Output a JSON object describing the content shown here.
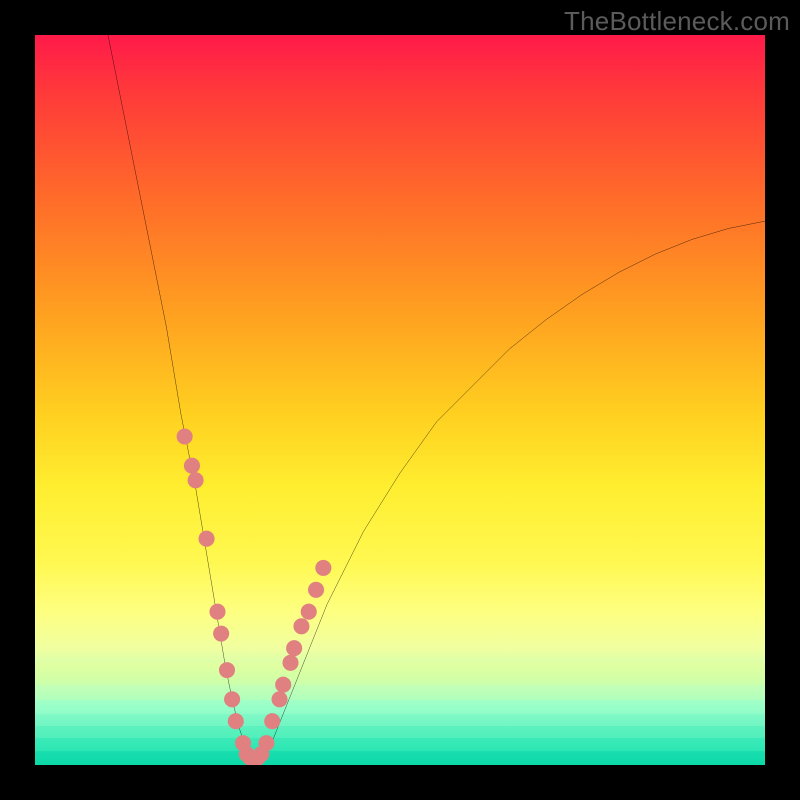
{
  "watermark": "TheBottleneck.com",
  "colors": {
    "background": "#000000",
    "watermark_text": "#5b5b5b",
    "curve_stroke": "#000000",
    "dot_fill": "#e08080",
    "gradient_top": "#ff1a4a",
    "gradient_bottom": "#0cd8a8"
  },
  "chart_data": {
    "type": "line",
    "title": "",
    "xlabel": "",
    "ylabel": "",
    "xlim": [
      0,
      100
    ],
    "ylim": [
      0,
      100
    ],
    "grid": false,
    "series": [
      {
        "name": "bottleneck-curve",
        "x": [
          10,
          12,
          14,
          16,
          18,
          20,
          22,
          23,
          24,
          25,
          26,
          27,
          28,
          29,
          30,
          31,
          32,
          34,
          36,
          38,
          40,
          45,
          50,
          55,
          60,
          65,
          70,
          75,
          80,
          85,
          90,
          95,
          100
        ],
        "y": [
          100,
          90,
          80,
          70,
          60,
          48,
          38,
          32,
          26,
          20,
          14,
          9,
          5,
          2,
          0.5,
          0.5,
          2,
          7,
          12,
          17,
          22,
          32,
          40,
          47,
          52,
          57,
          61,
          64.5,
          67.5,
          70,
          72,
          73.5,
          74.5
        ]
      }
    ],
    "highlighted_points": {
      "name": "sample-dots",
      "x": [
        20.5,
        21.5,
        22.0,
        23.5,
        25.0,
        25.5,
        26.3,
        27.0,
        27.5,
        28.5,
        29.0,
        29.5,
        30.5,
        31.0,
        31.7,
        32.5,
        33.5,
        34.0,
        35.0,
        35.5,
        36.5,
        37.5,
        38.5,
        39.5
      ],
      "y": [
        45,
        41,
        39,
        31,
        21,
        18,
        13,
        9,
        6,
        3,
        1.5,
        1,
        1,
        1.5,
        3,
        6,
        9,
        11,
        14,
        16,
        19,
        21,
        24,
        27
      ]
    }
  }
}
